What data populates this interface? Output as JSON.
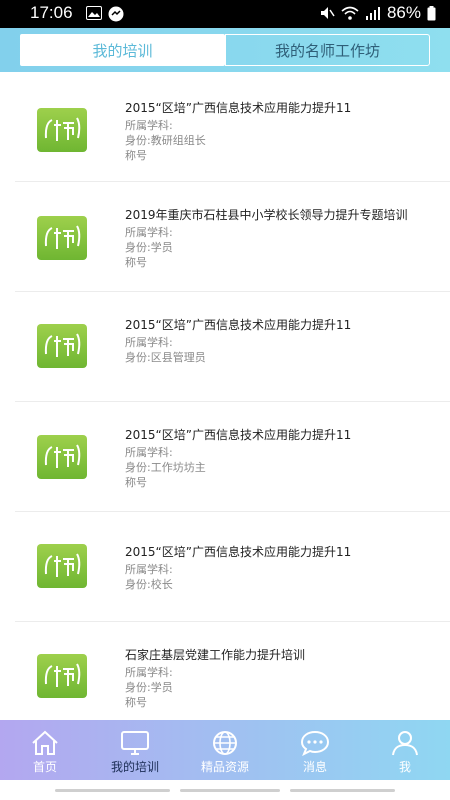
{
  "status_bar": {
    "time": "17:06",
    "battery": "86%"
  },
  "tabs": [
    {
      "label": "我的培训",
      "active": true
    },
    {
      "label": "我的名师工作坊",
      "active": false
    }
  ],
  "training_items": [
    {
      "title": "2015“区培”广西信息技术应用能力提升11",
      "subject": "所属学科:",
      "identity": "身份:教研组组长",
      "rank": "称号"
    },
    {
      "title": "2019年重庆市石柱县中小学校长领导力提升专题培训",
      "subject": "所属学科:",
      "identity": "身份:学员",
      "rank": "称号"
    },
    {
      "title": "2015“区培”广西信息技术应用能力提升11",
      "subject": "所属学科:",
      "identity": "身份:区县管理员",
      "rank": ""
    },
    {
      "title": "2015“区培”广西信息技术应用能力提升11",
      "subject": "所属学科:",
      "identity": "身份:工作坊坊主",
      "rank": "称号"
    },
    {
      "title": "2015“区培”广西信息技术应用能力提升11",
      "subject": "所属学科:",
      "identity": "身份:校长",
      "rank": ""
    },
    {
      "title": "石家庄基层党建工作能力提升培训",
      "subject": "所属学科:",
      "identity": "身份:学员",
      "rank": "称号"
    }
  ],
  "bottom_nav": [
    {
      "label": "首页",
      "icon": "home-icon"
    },
    {
      "label": "我的培训",
      "icon": "monitor-icon",
      "active": true
    },
    {
      "label": "精品资源",
      "icon": "globe-icon"
    },
    {
      "label": "消息",
      "icon": "chat-icon"
    },
    {
      "label": "我",
      "icon": "person-icon"
    }
  ],
  "colors": {
    "accent": "#5bb9d8",
    "header": "#82d0ec",
    "logo_green": "#7dbf3a"
  }
}
